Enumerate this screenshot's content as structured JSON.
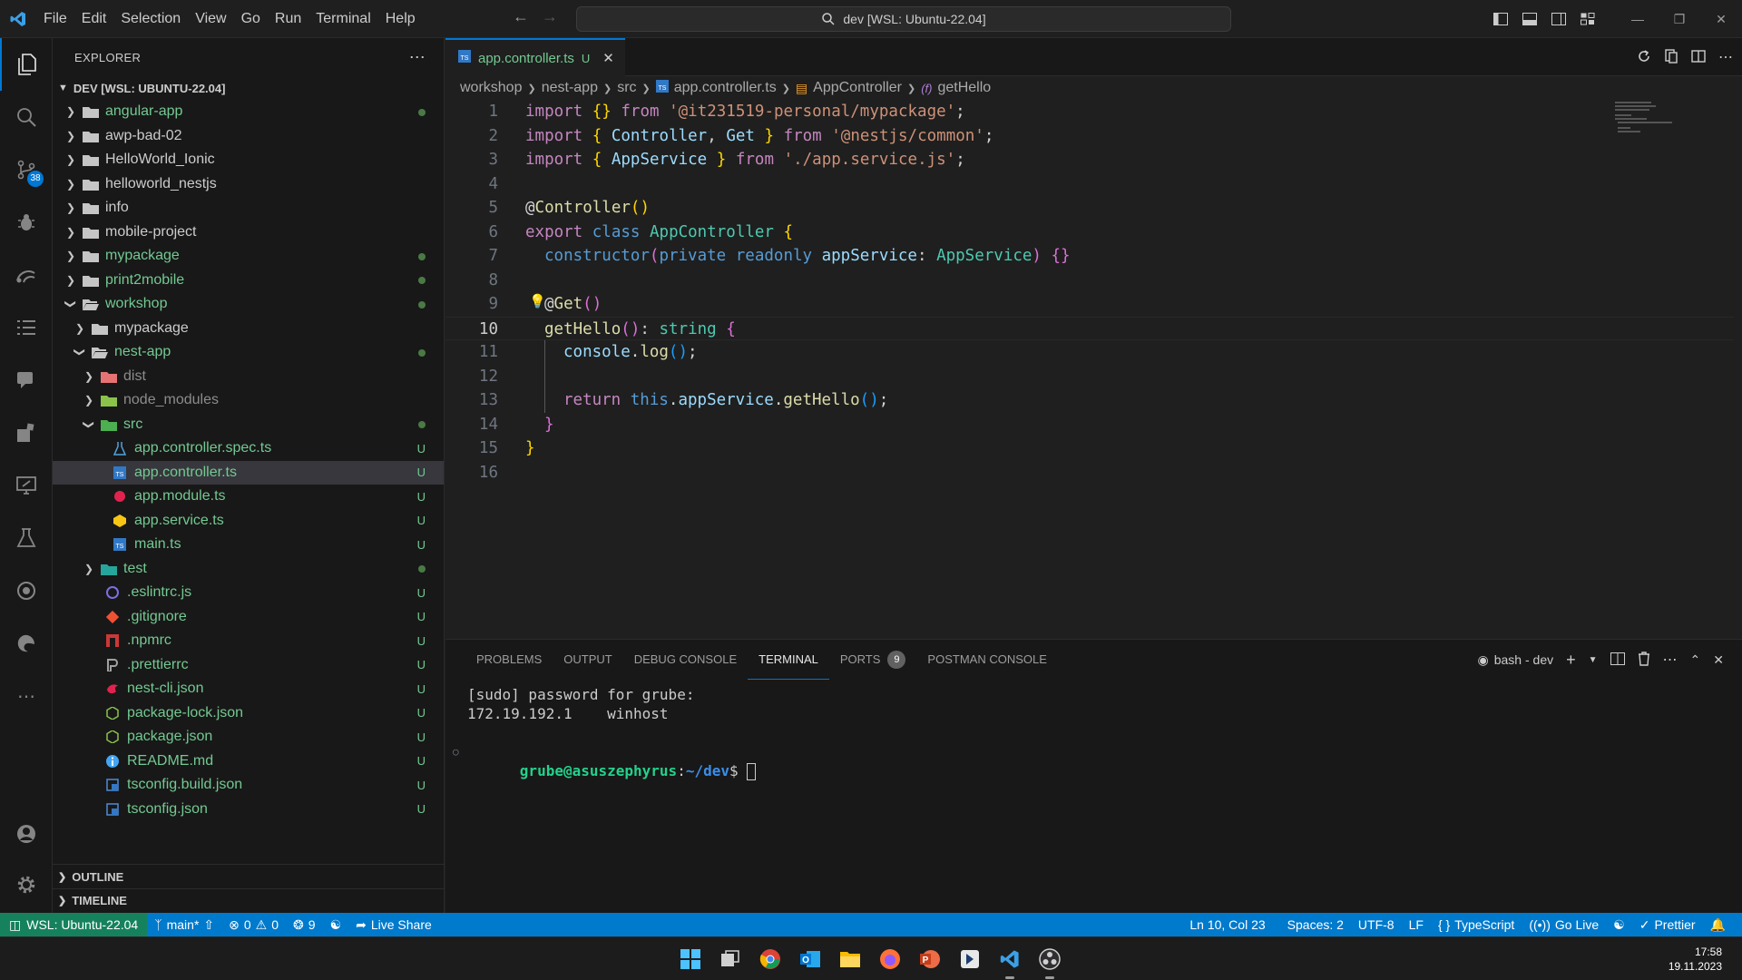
{
  "titlebar": {
    "menu": [
      "File",
      "Edit",
      "Selection",
      "View",
      "Go",
      "Run",
      "Terminal",
      "Help"
    ],
    "command_center": "dev [WSL: Ubuntu-22.04]"
  },
  "activity": {
    "scm_badge": "38"
  },
  "sidebar": {
    "title": "EXPLORER",
    "workspace": "DEV [WSL: UBUNTU-22.04]",
    "tree": [
      {
        "label": "angular-app",
        "status": "dot"
      },
      {
        "label": "awp-bad-02",
        "status": ""
      },
      {
        "label": "HelloWorld_Ionic",
        "status": ""
      },
      {
        "label": "helloworld_nestjs",
        "status": ""
      },
      {
        "label": "info",
        "status": ""
      },
      {
        "label": "mobile-project",
        "status": ""
      },
      {
        "label": "mypackage",
        "status": "dot"
      },
      {
        "label": "print2mobile",
        "status": "dot"
      },
      {
        "label": "workshop",
        "status": "dot"
      },
      {
        "label": "mypackage",
        "status": ""
      },
      {
        "label": "nest-app",
        "status": "dot"
      },
      {
        "label": "dist",
        "status": ""
      },
      {
        "label": "node_modules",
        "status": ""
      },
      {
        "label": "src",
        "status": "dot"
      },
      {
        "label": "app.controller.spec.ts",
        "status": "U"
      },
      {
        "label": "app.controller.ts",
        "status": "U"
      },
      {
        "label": "app.module.ts",
        "status": "U"
      },
      {
        "label": "app.service.ts",
        "status": "U"
      },
      {
        "label": "main.ts",
        "status": "U"
      },
      {
        "label": "test",
        "status": "dot"
      },
      {
        "label": ".eslintrc.js",
        "status": "U"
      },
      {
        "label": ".gitignore",
        "status": "U"
      },
      {
        "label": ".npmrc",
        "status": "U"
      },
      {
        "label": ".prettierrc",
        "status": "U"
      },
      {
        "label": "nest-cli.json",
        "status": "U"
      },
      {
        "label": "package-lock.json",
        "status": "U"
      },
      {
        "label": "package.json",
        "status": "U"
      },
      {
        "label": "README.md",
        "status": "U"
      },
      {
        "label": "tsconfig.build.json",
        "status": "U"
      },
      {
        "label": "tsconfig.json",
        "status": "U"
      }
    ],
    "outline": "OUTLINE",
    "timeline": "TIMELINE"
  },
  "editor": {
    "tab_label": "app.controller.ts",
    "tab_status": "U",
    "breadcrumb": [
      "workshop",
      "nest-app",
      "src",
      "app.controller.ts",
      "AppController",
      "getHello"
    ],
    "line_numbers": [
      "1",
      "2",
      "3",
      "4",
      "5",
      "6",
      "7",
      "8",
      "9",
      "10",
      "11",
      "12",
      "13",
      "14",
      "15",
      "16"
    ],
    "code": {
      "l1": {
        "import": "import",
        "braces": "{}",
        "from": "from",
        "str": "'@it231519-personal/mypackage'",
        "semi": ";"
      },
      "l2": {
        "import": "import",
        "ob": "{",
        "a": "Controller",
        "comma": ",",
        "b": "Get",
        "cb": "}",
        "from": "from",
        "str": "'@nestjs/common'",
        "semi": ";"
      },
      "l3": {
        "import": "import",
        "ob": "{",
        "a": "AppService",
        "cb": "}",
        "from": "from",
        "str": "'./app.service.js'",
        "semi": ";"
      },
      "l5": {
        "at": "@",
        "name": "Controller",
        "parens": "()"
      },
      "l6": {
        "export": "export",
        "class": "class",
        "name": "AppController",
        "ob": "{"
      },
      "l7": {
        "ctor": "constructor",
        "op": "(",
        "priv": "private",
        "ro": "readonly",
        "param": "appService",
        "colon": ":",
        "type": "AppService",
        "cp": ")",
        "body": "{}"
      },
      "l9": {
        "at": "@",
        "name": "Get",
        "parens": "()"
      },
      "l10": {
        "name": "getHello",
        "parens": "()",
        "colon": ":",
        "type": "string",
        "ob": "{"
      },
      "l11": {
        "obj": "console",
        "dot": ".",
        "fn": "log",
        "parens": "()",
        "semi": ";"
      },
      "l13": {
        "ret": "return",
        "this": "this",
        "dot": ".",
        "prop": "appService",
        "dot2": ".",
        "fn": "getHello",
        "parens": "()",
        "semi": ";"
      },
      "l14": {
        "cb": "}"
      },
      "l15": {
        "cb": "}"
      }
    }
  },
  "panel": {
    "tabs": [
      "PROBLEMS",
      "OUTPUT",
      "DEBUG CONSOLE",
      "TERMINAL",
      "PORTS",
      "POSTMAN CONSOLE"
    ],
    "ports_badge": "9",
    "shell_label": "bash - dev",
    "terminal": {
      "line1": "[sudo] password for grube:",
      "line2": "172.19.192.1    winhost",
      "prompt_user": "grube@asuszephyrus",
      "prompt_colon": ":",
      "prompt_path": "~/dev",
      "prompt_sign": "$ "
    }
  },
  "statusbar": {
    "remote": "WSL: Ubuntu-22.04",
    "branch": "main*",
    "errors": "0",
    "warnings": "0",
    "ports": "9",
    "live_share": "Live Share",
    "position": "Ln 10, Col 23",
    "spaces": "Spaces: 2",
    "encoding": "UTF-8",
    "eol": "LF",
    "language": "TypeScript",
    "go_live": "Go Live",
    "prettier": "Prettier"
  },
  "taskbar": {
    "time": "17:58",
    "date": "19.11.2023"
  },
  "colors": {
    "accent": "#0078d4",
    "statusbar": "#007acc",
    "remote": "#16825d",
    "git_untracked": "#73c991"
  },
  "icons": [
    "vscode-logo",
    "explorer-icon",
    "search-icon",
    "source-control-icon",
    "run-debug-icon",
    "remote-explorer-icon",
    "testing-icon",
    "account-icon",
    "gear-icon"
  ]
}
